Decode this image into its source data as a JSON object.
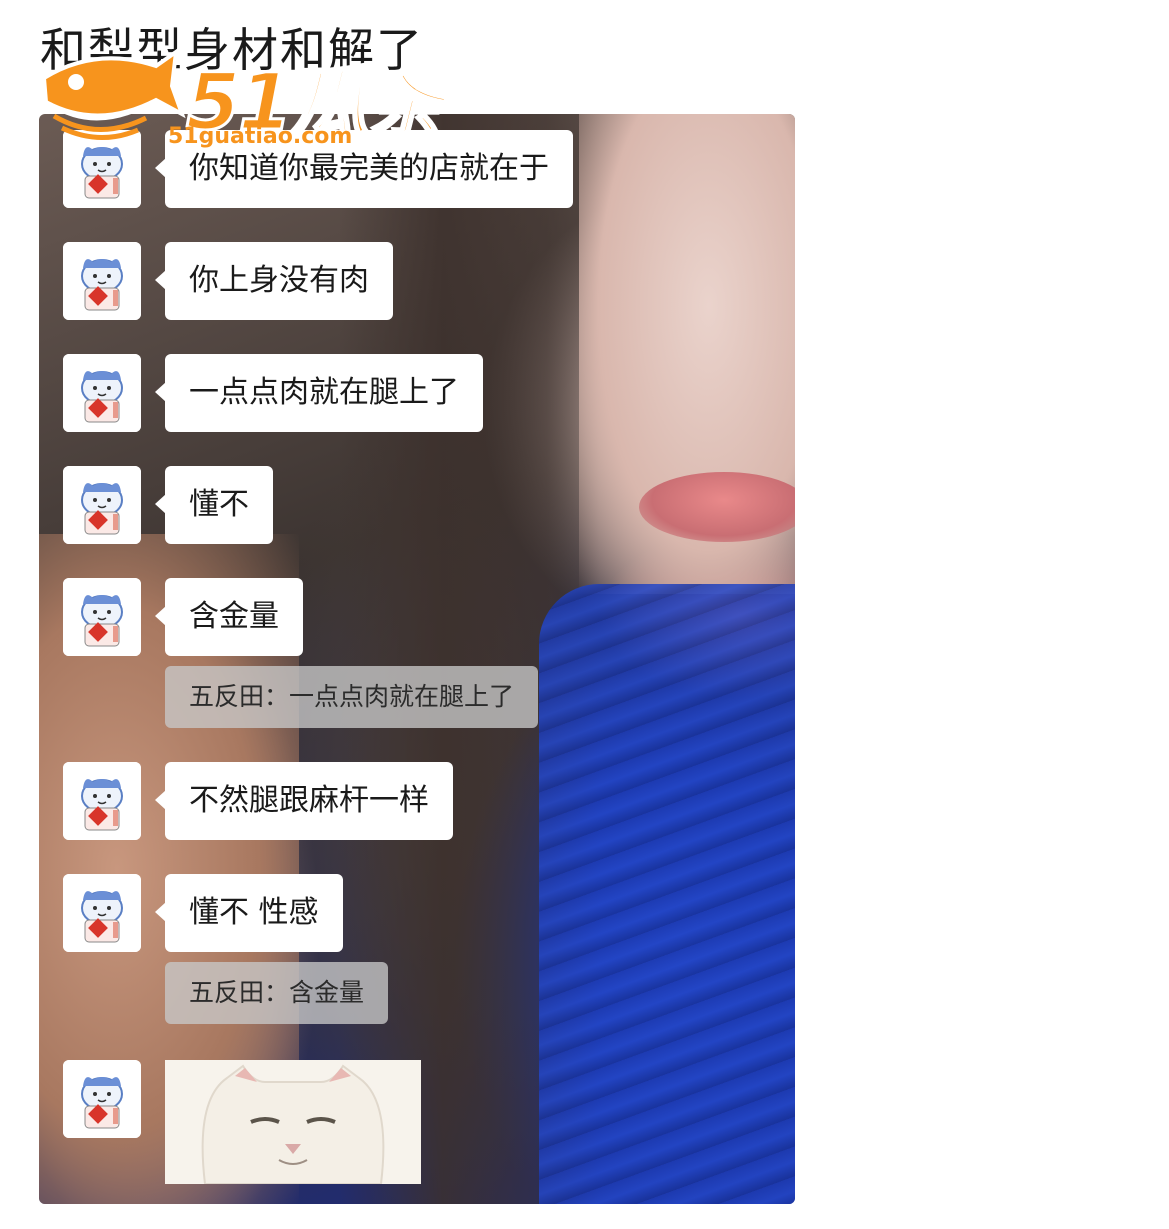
{
  "page": {
    "title": "和梨型身材和解了"
  },
  "watermark": {
    "main": "51瓜条",
    "url": "51guatiao.com"
  },
  "chat": {
    "messages": [
      {
        "type": "text",
        "text": "你知道你最完美的店就在于"
      },
      {
        "type": "text",
        "text": "你上身没有肉"
      },
      {
        "type": "text",
        "text": "一点点肉就在腿上了"
      },
      {
        "type": "text",
        "text": "懂不"
      },
      {
        "type": "text",
        "text": "含金量",
        "quote": "五反田：一点点肉就在腿上了"
      },
      {
        "type": "text",
        "text": "不然腿跟麻杆一样"
      },
      {
        "type": "text",
        "text": "懂不 性感",
        "quote": "五反田：含金量"
      },
      {
        "type": "sticker",
        "sticker_icon": "smug-white-cat-sticker"
      }
    ]
  },
  "colors": {
    "accent_orange": "#f7941d",
    "bubble": "#ffffff",
    "quote_bubble": "#c8c8c8"
  }
}
